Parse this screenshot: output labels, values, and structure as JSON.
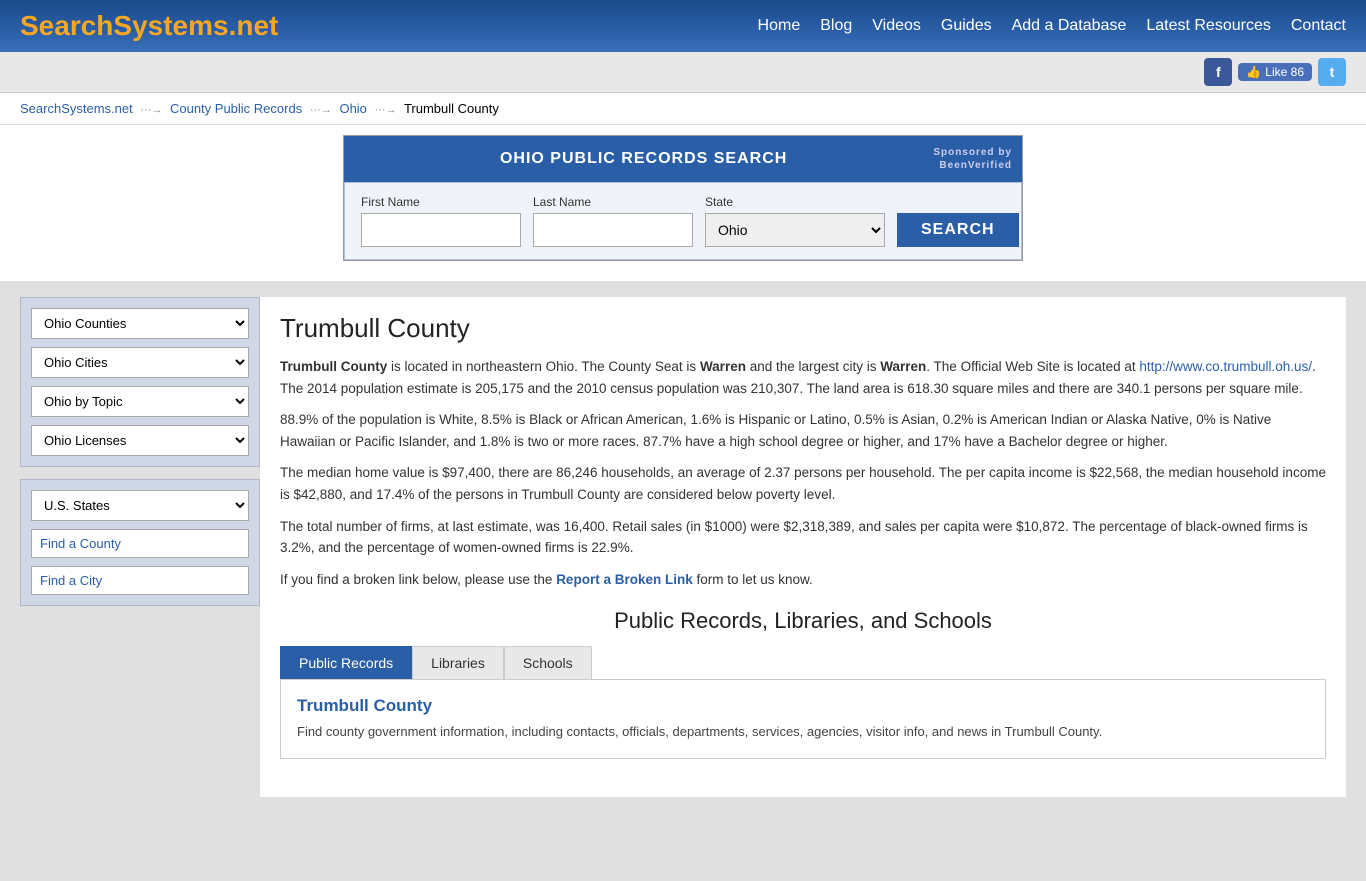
{
  "header": {
    "logo_text": "SearchSystems",
    "logo_ext": ".net",
    "nav_items": [
      "Home",
      "Blog",
      "Videos",
      "Guides",
      "Add a Database",
      "Latest Resources",
      "Contact"
    ]
  },
  "social": {
    "fb_label": "f",
    "like_label": "Like 86",
    "tw_label": "t"
  },
  "breadcrumb": {
    "items": [
      "SearchSystems.net",
      "County Public Records",
      "Ohio",
      "Trumbull County"
    ]
  },
  "search": {
    "header_title": "OHIO PUBLIC RECORDS SEARCH",
    "sponsored_line1": "Sponsored by",
    "sponsored_line2": "BeenVerified",
    "first_name_label": "First Name",
    "last_name_label": "Last Name",
    "state_label": "State",
    "state_value": "Ohio",
    "search_button": "SEARCH"
  },
  "sidebar": {
    "panel1": {
      "dropdown1": "Ohio Counties",
      "dropdown2": "Ohio Cities",
      "dropdown3": "Ohio by Topic",
      "dropdown4": "Ohio Licenses"
    },
    "panel2": {
      "dropdown1": "U.S. States",
      "link1": "Find a County",
      "link2": "Find a City"
    }
  },
  "main": {
    "county_title": "Trumbull County",
    "desc1": " is located in northeastern Ohio.  The County Seat is ",
    "county_seat": "Warren",
    "desc2": " and the largest city is ",
    "largest_city": "Warren",
    "desc3": ".  The Official Web Site is located at ",
    "website": "http://www.co.trumbull.oh.us/",
    "desc4": ".  The 2014 population estimate is 205,175 and the 2010 census population was 210,307.  The land area is 618.30 square miles and there are 340.1 persons per square mile.",
    "para2": "88.9% of the population is White, 8.5% is Black or African American, 1.6% is Hispanic or Latino, 0.5% is Asian, 0.2% is American Indian or Alaska Native, 0% is Native Hawaiian or Pacific Islander, and 1.8% is two or more races.  87.7% have a high school degree or higher, and 17% have a Bachelor degree or higher.",
    "para3": "The median home value is $97,400, there are 86,246 households, an average of 2.37 persons per household.  The per capita income is $22,568,  the median household income is $42,880, and 17.4% of the persons in Trumbull County are considered below poverty level.",
    "para4": "The total number of firms, at last estimate, was 16,400.  Retail sales (in $1000) were $2,318,389, and sales per capita were $10,872.  The percentage of black-owned firms is 3.2%, and the percentage of women-owned firms is 22.9%.",
    "broken_link_text1": "If you find a broken link below, please use the ",
    "broken_link_anchor": "Report a Broken Link",
    "broken_link_text2": " form to let us know.",
    "section_title": "Public Records, Libraries, and Schools",
    "tabs": [
      "Public Records",
      "Libraries",
      "Schools"
    ],
    "active_tab": 0,
    "tab_content": {
      "title": "Trumbull County",
      "desc": "Find county government information, including contacts, officials, departments, services, agencies, visitor info, and news in Trumbull County."
    }
  }
}
